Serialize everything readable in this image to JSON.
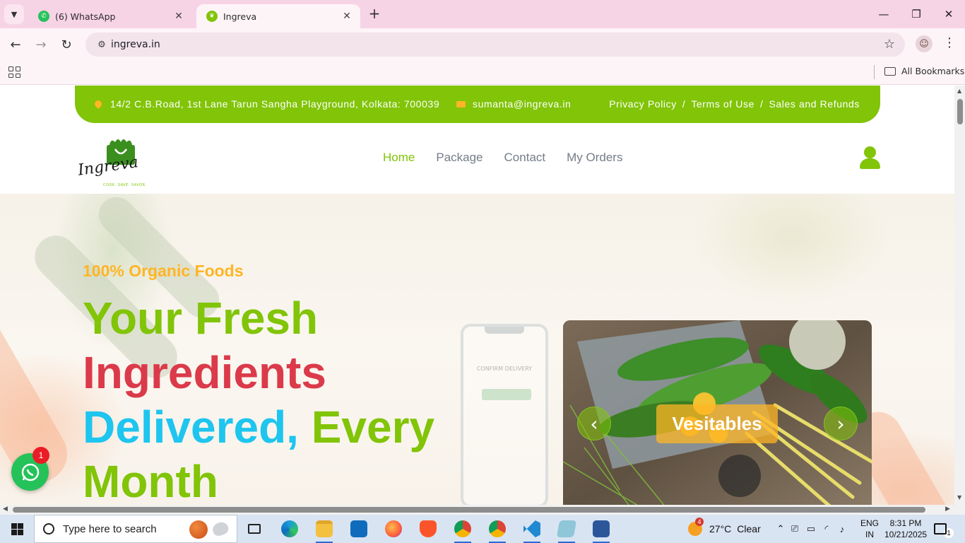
{
  "browser": {
    "tabs": [
      {
        "title": "(6) WhatsApp",
        "active": false
      },
      {
        "title": "Ingreva",
        "active": true
      }
    ],
    "url": "ingreva.in",
    "bookmarks_label": "All Bookmarks"
  },
  "topbar": {
    "address": "14/2 C.B.Road, 1st Lane Tarun Sangha Playground, Kolkata: 700039",
    "email": "sumanta@ingreva.in",
    "links": [
      "Privacy Policy",
      "Terms of Use",
      "Sales and Refunds"
    ],
    "separator": "/"
  },
  "logo": {
    "text": "Ingreva",
    "tagline": "COOK. SAVE. SAVOR."
  },
  "nav": {
    "items": [
      "Home",
      "Package",
      "Contact",
      "My Orders"
    ],
    "active": "Home"
  },
  "hero": {
    "subtitle": "100% Organic Foods",
    "headline": {
      "line1": "Your Fresh",
      "line2": "Ingredients",
      "line3a": "Delivered,",
      "line3b": " Every",
      "line4": "Month"
    },
    "phone_text": "CONFIRM DELIVERY",
    "carousel_label": "Vesitables"
  },
  "whatsapp": {
    "badge": "1"
  },
  "taskbar": {
    "search_placeholder": "Type here to search",
    "weather": {
      "temp": "27°C",
      "condition": "Clear",
      "badge": "4"
    },
    "lang_top": "ENG",
    "lang_bottom": "IN",
    "time": "8:31 PM",
    "date": "10/21/2025",
    "notification_count": "1"
  },
  "colors": {
    "brand_green": "#81c408",
    "accent_orange": "#ffb524",
    "headline_red": "#db3a4a",
    "headline_blue": "#1ec5ef",
    "tab_strip": "#f7d3e6"
  }
}
